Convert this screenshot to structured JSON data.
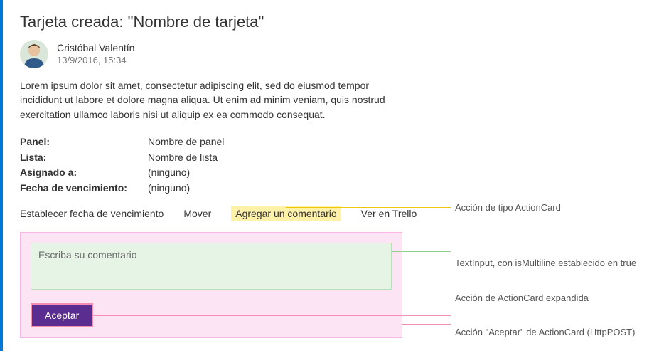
{
  "title": "Tarjeta creada: \"Nombre de tarjeta\"",
  "author": {
    "name": "Cristóbal Valentín",
    "date": "13/9/2016, 15:34"
  },
  "body": "Lorem ipsum dolor sit amet, consectetur adipiscing elit, sed do eiusmod tempor incididunt ut labore et dolore magna aliqua. Ut enim ad minim veniam, quis nostrud exercitation ullamco laboris nisi ut aliquip ex ea commodo consequat.",
  "facts": [
    {
      "label": "Panel:",
      "value": "Nombre de panel"
    },
    {
      "label": "Lista:",
      "value": "Nombre de lista"
    },
    {
      "label": "Asignado a:",
      "value": "(ninguno)"
    },
    {
      "label": "Fecha de vencimiento:",
      "value": "(ninguno)"
    }
  ],
  "actions": {
    "set_due": "Establecer fecha de vencimiento",
    "move": "Mover",
    "add_comment": "Agregar un comentario",
    "view": "Ver en Trello"
  },
  "comment": {
    "placeholder": "Escriba su comentario",
    "submit": "Aceptar"
  },
  "annotations": {
    "actioncard": "Acción de tipo ActionCard",
    "textinput": "TextInput, con isMultiline establecido en true",
    "expanded": "Acción de ActionCard expandida",
    "httppost": "Acción \"Aceptar\" de ActionCard (HttpPOST)"
  }
}
